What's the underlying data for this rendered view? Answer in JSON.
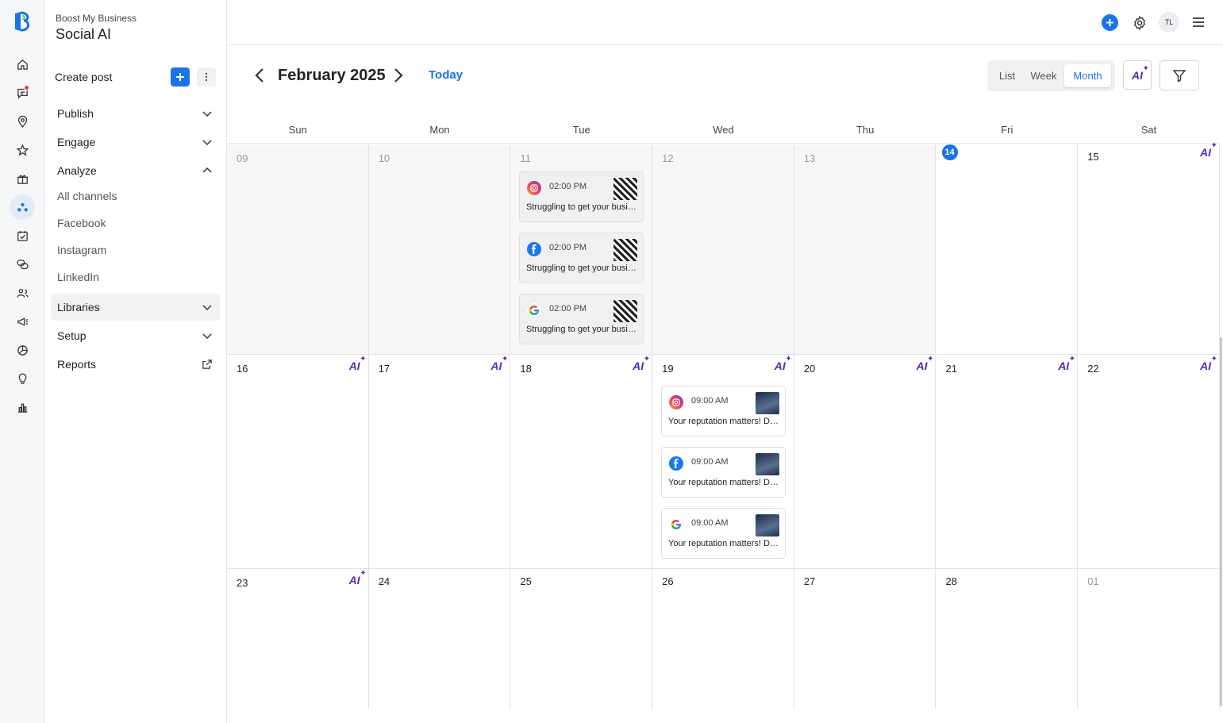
{
  "app": {
    "org": "Boost My Business",
    "name": "Social AI"
  },
  "rail": {
    "icons": [
      "home-icon",
      "messages-icon",
      "location-icon",
      "star-icon",
      "gift-icon",
      "social-icon",
      "tasks-icon",
      "chat-icon",
      "contacts-icon",
      "campaigns-icon",
      "insights-icon",
      "ideas-icon",
      "reports-icon"
    ]
  },
  "nav": {
    "create_label": "Create post",
    "items": {
      "publish": "Publish",
      "engage": "Engage",
      "analyze": "Analyze",
      "libraries": "Libraries",
      "setup": "Setup",
      "reports": "Reports"
    },
    "analyze_sub": [
      "All channels",
      "Facebook",
      "Instagram",
      "LinkedIn"
    ]
  },
  "topbar": {
    "avatar": "TL"
  },
  "calendar": {
    "title": "February 2025",
    "today_label": "Today",
    "views": [
      "List",
      "Week",
      "Month"
    ],
    "active_view": "Month",
    "ai_label": "AI",
    "weekdays": [
      "Sun",
      "Mon",
      "Tue",
      "Wed",
      "Thu",
      "Fri",
      "Sat"
    ],
    "weeks": [
      [
        "09",
        "10",
        "11",
        "12",
        "13",
        "14",
        "15"
      ],
      [
        "16",
        "17",
        "18",
        "19",
        "20",
        "21",
        "22"
      ],
      [
        "23",
        "24",
        "25",
        "26",
        "27",
        "28",
        "01"
      ]
    ],
    "today": "14"
  },
  "posts": {
    "tue_11": [
      {
        "channel": "instagram",
        "time": "02:00 PM",
        "text": "Struggling to get your business noticed?"
      },
      {
        "channel": "facebook",
        "time": "02:00 PM",
        "text": "Struggling to get your business noticed?"
      },
      {
        "channel": "google",
        "time": "02:00 PM",
        "text": "Struggling to get your business noticed?"
      }
    ],
    "wed_19": [
      {
        "channel": "instagram",
        "time": "09:00 AM",
        "text": "Your reputation matters! Don't let it slip."
      },
      {
        "channel": "facebook",
        "time": "09:00 AM",
        "text": "Your reputation matters! Don't let it slip."
      },
      {
        "channel": "google",
        "time": "09:00 AM",
        "text": "Your reputation matters! Don't let it slip."
      }
    ]
  },
  "colors": {
    "accent": "#1a73e8",
    "ai": "#5b2bb5",
    "notification": "#e53935"
  }
}
